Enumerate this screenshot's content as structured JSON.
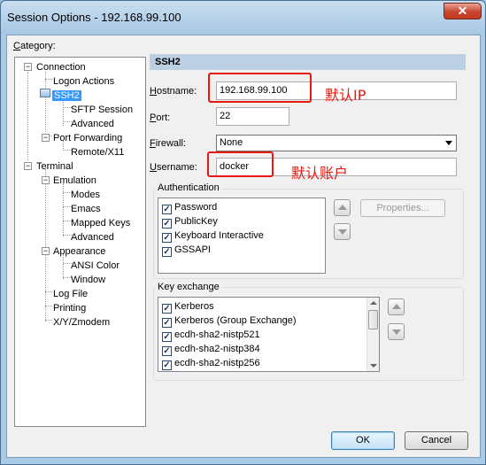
{
  "window": {
    "title": "Session Options - 192.168.99.100",
    "close_glyph": "✕"
  },
  "category": {
    "label_prefix": "C",
    "label_rest": "ategory:",
    "tree": [
      {
        "label": "Connection",
        "expander": "−"
      },
      {
        "label": "Logon Actions"
      },
      {
        "label": "SSH2",
        "selected": true
      },
      {
        "label": "SFTP Session"
      },
      {
        "label": "Advanced"
      },
      {
        "label": "Port Forwarding",
        "expander": "−"
      },
      {
        "label": "Remote/X11"
      },
      {
        "label": "Terminal",
        "expander": "−"
      },
      {
        "label": "Emulation",
        "expander": "−"
      },
      {
        "label": "Modes"
      },
      {
        "label": "Emacs"
      },
      {
        "label": "Mapped Keys"
      },
      {
        "label": "Advanced"
      },
      {
        "label": "Appearance",
        "expander": "−"
      },
      {
        "label": "ANSI Color"
      },
      {
        "label": "Window"
      },
      {
        "label": "Log File"
      },
      {
        "label": "Printing"
      },
      {
        "label": "X/Y/Zmodem"
      }
    ]
  },
  "panel": {
    "header": "SSH2",
    "hostname_label": {
      "accel": "H",
      "rest": "ostname:"
    },
    "hostname_value": "192.168.99.100",
    "port_label": {
      "accel": "P",
      "rest": "ort:"
    },
    "port_value": "22",
    "firewall_label": {
      "accel": "F",
      "rest": "irewall:"
    },
    "firewall_value": "None",
    "username_label": {
      "accel": "U",
      "rest": "sername:"
    },
    "username_value": "docker",
    "annotation_ip": "默认IP",
    "annotation_account": "默认账户",
    "highlight_color": "#e8190f"
  },
  "authentication": {
    "title": "Authentication",
    "items": [
      {
        "label": "Password",
        "checked": true
      },
      {
        "label": "PublicKey",
        "checked": true
      },
      {
        "label": "Keyboard Interactive",
        "checked": true
      },
      {
        "label": "GSSAPI",
        "checked": true
      }
    ],
    "properties_button": "Properties..."
  },
  "key_exchange": {
    "title": "Key exchange",
    "items": [
      {
        "label": "Kerberos",
        "checked": true
      },
      {
        "label": "Kerberos (Group Exchange)",
        "checked": true
      },
      {
        "label": "ecdh-sha2-nistp521",
        "checked": true
      },
      {
        "label": "ecdh-sha2-nistp384",
        "checked": true
      },
      {
        "label": "ecdh-sha2-nistp256",
        "checked": true
      }
    ]
  },
  "buttons": {
    "ok": "OK",
    "cancel": "Cancel"
  },
  "check_glyph": "✓"
}
